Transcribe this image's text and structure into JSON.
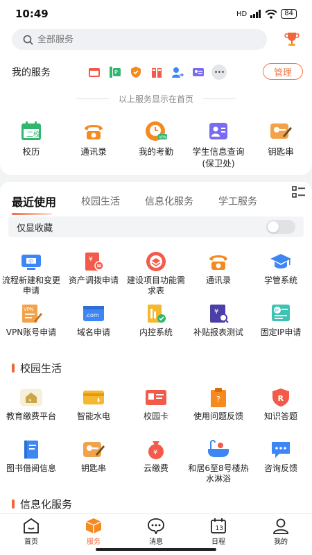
{
  "status": {
    "time": "10:49",
    "network": "HD",
    "battery": "84"
  },
  "search": {
    "placeholder": "全部服务"
  },
  "my_services": {
    "title": "我的服务",
    "manage_label": "管理",
    "divider_text": "以上服务显示在首页",
    "items": [
      {
        "label": "校历",
        "icon": "calendar-icon"
      },
      {
        "label": "通讯录",
        "icon": "phone-icon"
      },
      {
        "label": "我的考勤",
        "icon": "attendance-icon"
      },
      {
        "label": "学生信息查询(保卫处)",
        "icon": "student-info-icon"
      },
      {
        "label": "钥匙串",
        "icon": "key-icon"
      }
    ]
  },
  "tabs": [
    "最近使用",
    "校园生活",
    "信息化服务",
    "学工服务"
  ],
  "favorites": {
    "label": "仅显收藏",
    "on": false
  },
  "recent": [
    {
      "label": "流程新建和变更申请",
      "icon": "workflow-icon"
    },
    {
      "label": "资产调拨申请",
      "icon": "asset-transfer-icon"
    },
    {
      "label": "建设项目功能需求表",
      "icon": "project-icon"
    },
    {
      "label": "通讯录",
      "icon": "phone-icon"
    },
    {
      "label": "学管系统",
      "icon": "graduation-cap-icon"
    },
    {
      "label": "VPN账号申请",
      "icon": "vpn-icon"
    },
    {
      "label": "域名申请",
      "icon": "domain-icon"
    },
    {
      "label": "内控系统",
      "icon": "internal-control-icon"
    },
    {
      "label": "补贴报表测试",
      "icon": "subsidy-report-icon"
    },
    {
      "label": "固定IP申请",
      "icon": "ip-icon"
    }
  ],
  "campus_life": {
    "title": "校园生活",
    "items": [
      {
        "label": "教育缴费平台",
        "icon": "education-pay-icon"
      },
      {
        "label": "智能水电",
        "icon": "utility-card-icon"
      },
      {
        "label": "校园卡",
        "icon": "campus-card-icon"
      },
      {
        "label": "使用问题反馈",
        "icon": "clipboard-icon"
      },
      {
        "label": "知识答题",
        "icon": "quiz-shield-icon"
      },
      {
        "label": "图书借阅信息",
        "icon": "book-icon"
      },
      {
        "label": "钥匙串",
        "icon": "key-icon"
      },
      {
        "label": "云缴费",
        "icon": "money-bag-icon"
      },
      {
        "label": "和居6至8号楼热水淋浴",
        "icon": "bathtub-icon"
      },
      {
        "label": "咨询反馈",
        "icon": "chat-icon"
      }
    ]
  },
  "info_service": {
    "title": "信息化服务"
  },
  "bottom_nav": [
    {
      "label": "首页",
      "icon": "home-icon",
      "active": false
    },
    {
      "label": "服务",
      "icon": "service-box-icon",
      "active": true
    },
    {
      "label": "消息",
      "icon": "message-icon",
      "active": false
    },
    {
      "label": "日程",
      "icon": "schedule-icon",
      "active": false
    },
    {
      "label": "我的",
      "icon": "profile-icon",
      "active": false
    }
  ],
  "colors": {
    "accent": "#f0663a",
    "blue": "#3f86f5",
    "green": "#2fb66f",
    "orange": "#f58a1f",
    "purple": "#7a6cf0"
  }
}
